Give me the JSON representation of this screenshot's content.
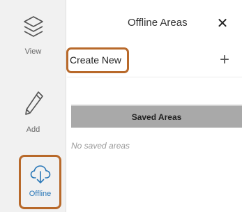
{
  "sidebar": {
    "items": [
      {
        "label": "View",
        "icon": "layers-icon"
      },
      {
        "label": "Add",
        "icon": "pencil-icon"
      },
      {
        "label": "Offline",
        "icon": "cloud-download-icon"
      }
    ]
  },
  "panel": {
    "title": "Offline Areas",
    "close_label": "✕",
    "create_label": "Create New",
    "add_label": "+",
    "saved_header": "Saved Areas",
    "empty_message": "No saved areas"
  },
  "colors": {
    "highlight_border": "#b8692a",
    "active_item": "#2a78b8",
    "section_header_bg": "#a9a9a9",
    "sidebar_bg": "#f1f1f1"
  }
}
